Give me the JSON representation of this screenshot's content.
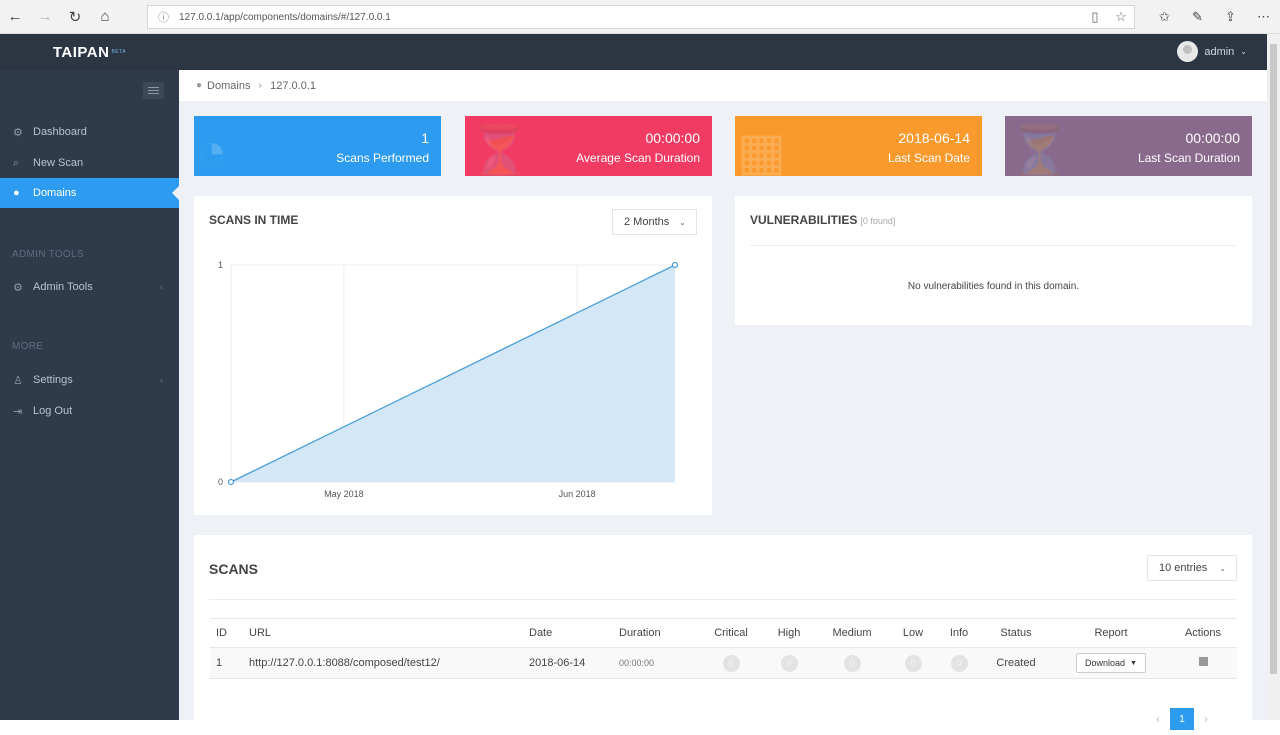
{
  "browser": {
    "url": "127.0.0.1/app/components/domains/#/127.0.0.1",
    "back_icon": "←",
    "forward_icon": "→",
    "refresh_icon": "↻",
    "home_icon": "⌂",
    "info_icon": "ⓘ",
    "reading_icon": "▯",
    "star_icon": "☆",
    "favorites_icon": "✩",
    "pen_icon": "✎",
    "share_icon": "⇪",
    "more_icon": "⋯"
  },
  "header": {
    "logo": "TAIPAN",
    "logo_badge": "BETA",
    "user": "admin",
    "user_caret": "⌄"
  },
  "sidebar": {
    "items": [
      {
        "label": "Dashboard",
        "icon": "⚙"
      },
      {
        "label": "New Scan",
        "icon": "⌕"
      },
      {
        "label": "Domains",
        "icon": "●"
      },
      {
        "label": "Admin Tools",
        "icon": "⚙"
      },
      {
        "label": "Settings",
        "icon": "♙"
      },
      {
        "label": "Log Out",
        "icon": "⇥"
      }
    ],
    "section_admin": "ADMIN TOOLS",
    "section_more": "MORE",
    "chevron": "‹"
  },
  "breadcrumb": {
    "root": "Domains",
    "separator": "›",
    "current": "127.0.0.1"
  },
  "stats": [
    {
      "value": "1",
      "label": "Scans Performed",
      "color": "#2d9cf0",
      "icon": "◔"
    },
    {
      "value": "00:00:00",
      "label": "Average Scan Duration",
      "color": "#f23b63",
      "icon": "⏳"
    },
    {
      "value": "2018-06-14",
      "label": "Last Scan Date",
      "color": "#fa9a2c",
      "icon": "▦"
    },
    {
      "value": "00:00:00",
      "label": "Last Scan Duration",
      "color": "#8a6a8c",
      "icon": "⏳"
    }
  ],
  "scans_chart": {
    "title": "SCANS IN TIME",
    "range_select": "2 Months",
    "caret": "⌄"
  },
  "chart_data": {
    "type": "area",
    "x": [
      "2018-04-16",
      "2018-06-14"
    ],
    "y": [
      0,
      1
    ],
    "x_tick_labels": [
      "May 2018",
      "Jun 2018"
    ],
    "y_tick_labels": [
      "0",
      "1"
    ],
    "ylim": [
      0,
      1
    ],
    "grid": true,
    "fill_color": "#d4e7f7",
    "line_color": "#4a9fd8"
  },
  "vulnerabilities": {
    "title": "VULNERABILITIES",
    "count_text": "[0 found]",
    "empty_text": "No vulnerabilities found in this domain."
  },
  "scans_table": {
    "title": "SCANS",
    "entries_select": "10 entries",
    "caret": "⌄",
    "columns": [
      "ID",
      "URL",
      "Date",
      "Duration",
      "Critical",
      "High",
      "Medium",
      "Low",
      "Info",
      "Status",
      "Report",
      "Actions"
    ],
    "rows": [
      {
        "id": "1",
        "url": "http://127.0.0.1:8088/composed/test12/",
        "date": "2018-06-14",
        "duration": "00:00:00",
        "critical": "0",
        "high": "0",
        "medium": "0",
        "low": "0",
        "info": "0",
        "status": "Created",
        "report": "Download"
      }
    ]
  },
  "pagination": {
    "prev": "‹",
    "current": "1",
    "next": "›"
  }
}
